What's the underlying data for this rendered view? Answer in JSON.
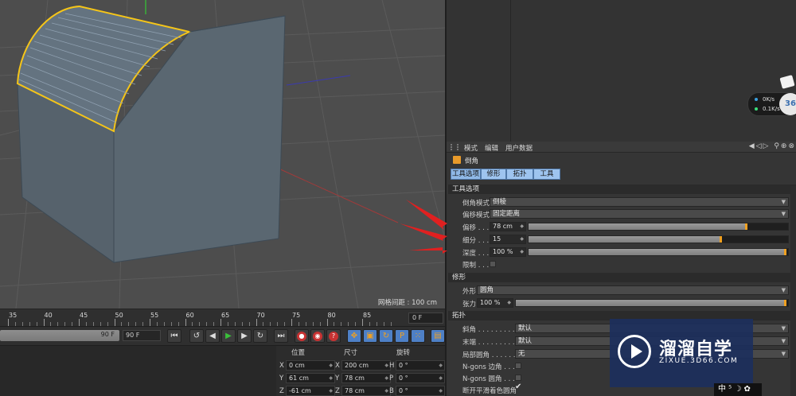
{
  "viewport": {
    "grid_spacing_label": "网格间距 : 100 cm"
  },
  "timeline": {
    "ticks": [
      "35",
      "40",
      "45",
      "50",
      "55",
      "60",
      "65",
      "70",
      "75",
      "80",
      "85"
    ],
    "current_frame": "0 F"
  },
  "transport": {
    "range_end": "90 F",
    "end_frame": "90 F",
    "buttons": [
      "⏮",
      "◀◀",
      "◀|",
      "▶",
      "▶|",
      "▶▶",
      "⏭"
    ]
  },
  "coords": {
    "headers": {
      "position": "位置",
      "size": "尺寸",
      "rotation": "旋转"
    },
    "rows": [
      {
        "axis": "X",
        "pos": "0 cm",
        "size_axis": "X",
        "size": "200 cm",
        "rot_axis": "H",
        "rot": "0 °"
      },
      {
        "axis": "Y",
        "pos": "61 cm",
        "size_axis": "Y",
        "size": "78 cm",
        "rot_axis": "P",
        "rot": "0 °"
      },
      {
        "axis": "Z",
        "pos": "-61 cm",
        "size_axis": "Z",
        "size": "78 cm",
        "rot_axis": "B",
        "rot": "0 °"
      }
    ]
  },
  "speed_widget": {
    "upload": "0K/s",
    "download": "0.1K/s",
    "badge": "36"
  },
  "attr": {
    "menu": [
      "模式",
      "编辑",
      "用户数据"
    ],
    "object_name": "倒角",
    "tabs": [
      "工具选项",
      "修形",
      "拓扑",
      "工具"
    ],
    "sections": {
      "tool_options": "工具选项",
      "shaping": "修形",
      "topology": "拓扑"
    },
    "tool_options": {
      "bevel_mode_label": "倒角模式",
      "bevel_mode_value": "倒棱",
      "offset_mode_label": "偏移模式",
      "offset_mode_value": "固定距离",
      "offset_label": "偏移 . . .",
      "offset_value": "78 cm",
      "offset_fraction": 0.85,
      "subdiv_label": "细分 . . .",
      "subdiv_value": "15",
      "subdiv_fraction": 0.75,
      "depth_label": "深度 . . .",
      "depth_value": "100 %",
      "depth_fraction": 1.0,
      "limit_label": "限制 . . ."
    },
    "shaping": {
      "shape_label": "外形",
      "shape_value": "圆角",
      "tension_label": "张力",
      "tension_value": "100 %",
      "tension_fraction": 1.0
    },
    "topology": {
      "miter_label": "斜角 . . . . . . . . . .",
      "miter_value": "默认",
      "end_label": "末端 . . . . . . . . . .",
      "end_value": "默认",
      "round_label": "局部圆角 . . . . . . .",
      "round_value": "无",
      "ngons_edge_label": "N-gons 边角 . . .",
      "ngons_round_label": "N-gons 圆角 . . .",
      "phong_label": "断开平滑着色圆角"
    }
  },
  "watermark": {
    "title": "溜溜自学",
    "url": "ZIXUE.3D66.COM"
  },
  "ime": {
    "text": "中 ⁵ ☽ ✿"
  },
  "colors": {
    "selection_yellow": "#f5c518",
    "accent_orange": "#f0a020",
    "tab_blue": "#9ec4ef",
    "arrow_red": "#e02020"
  }
}
